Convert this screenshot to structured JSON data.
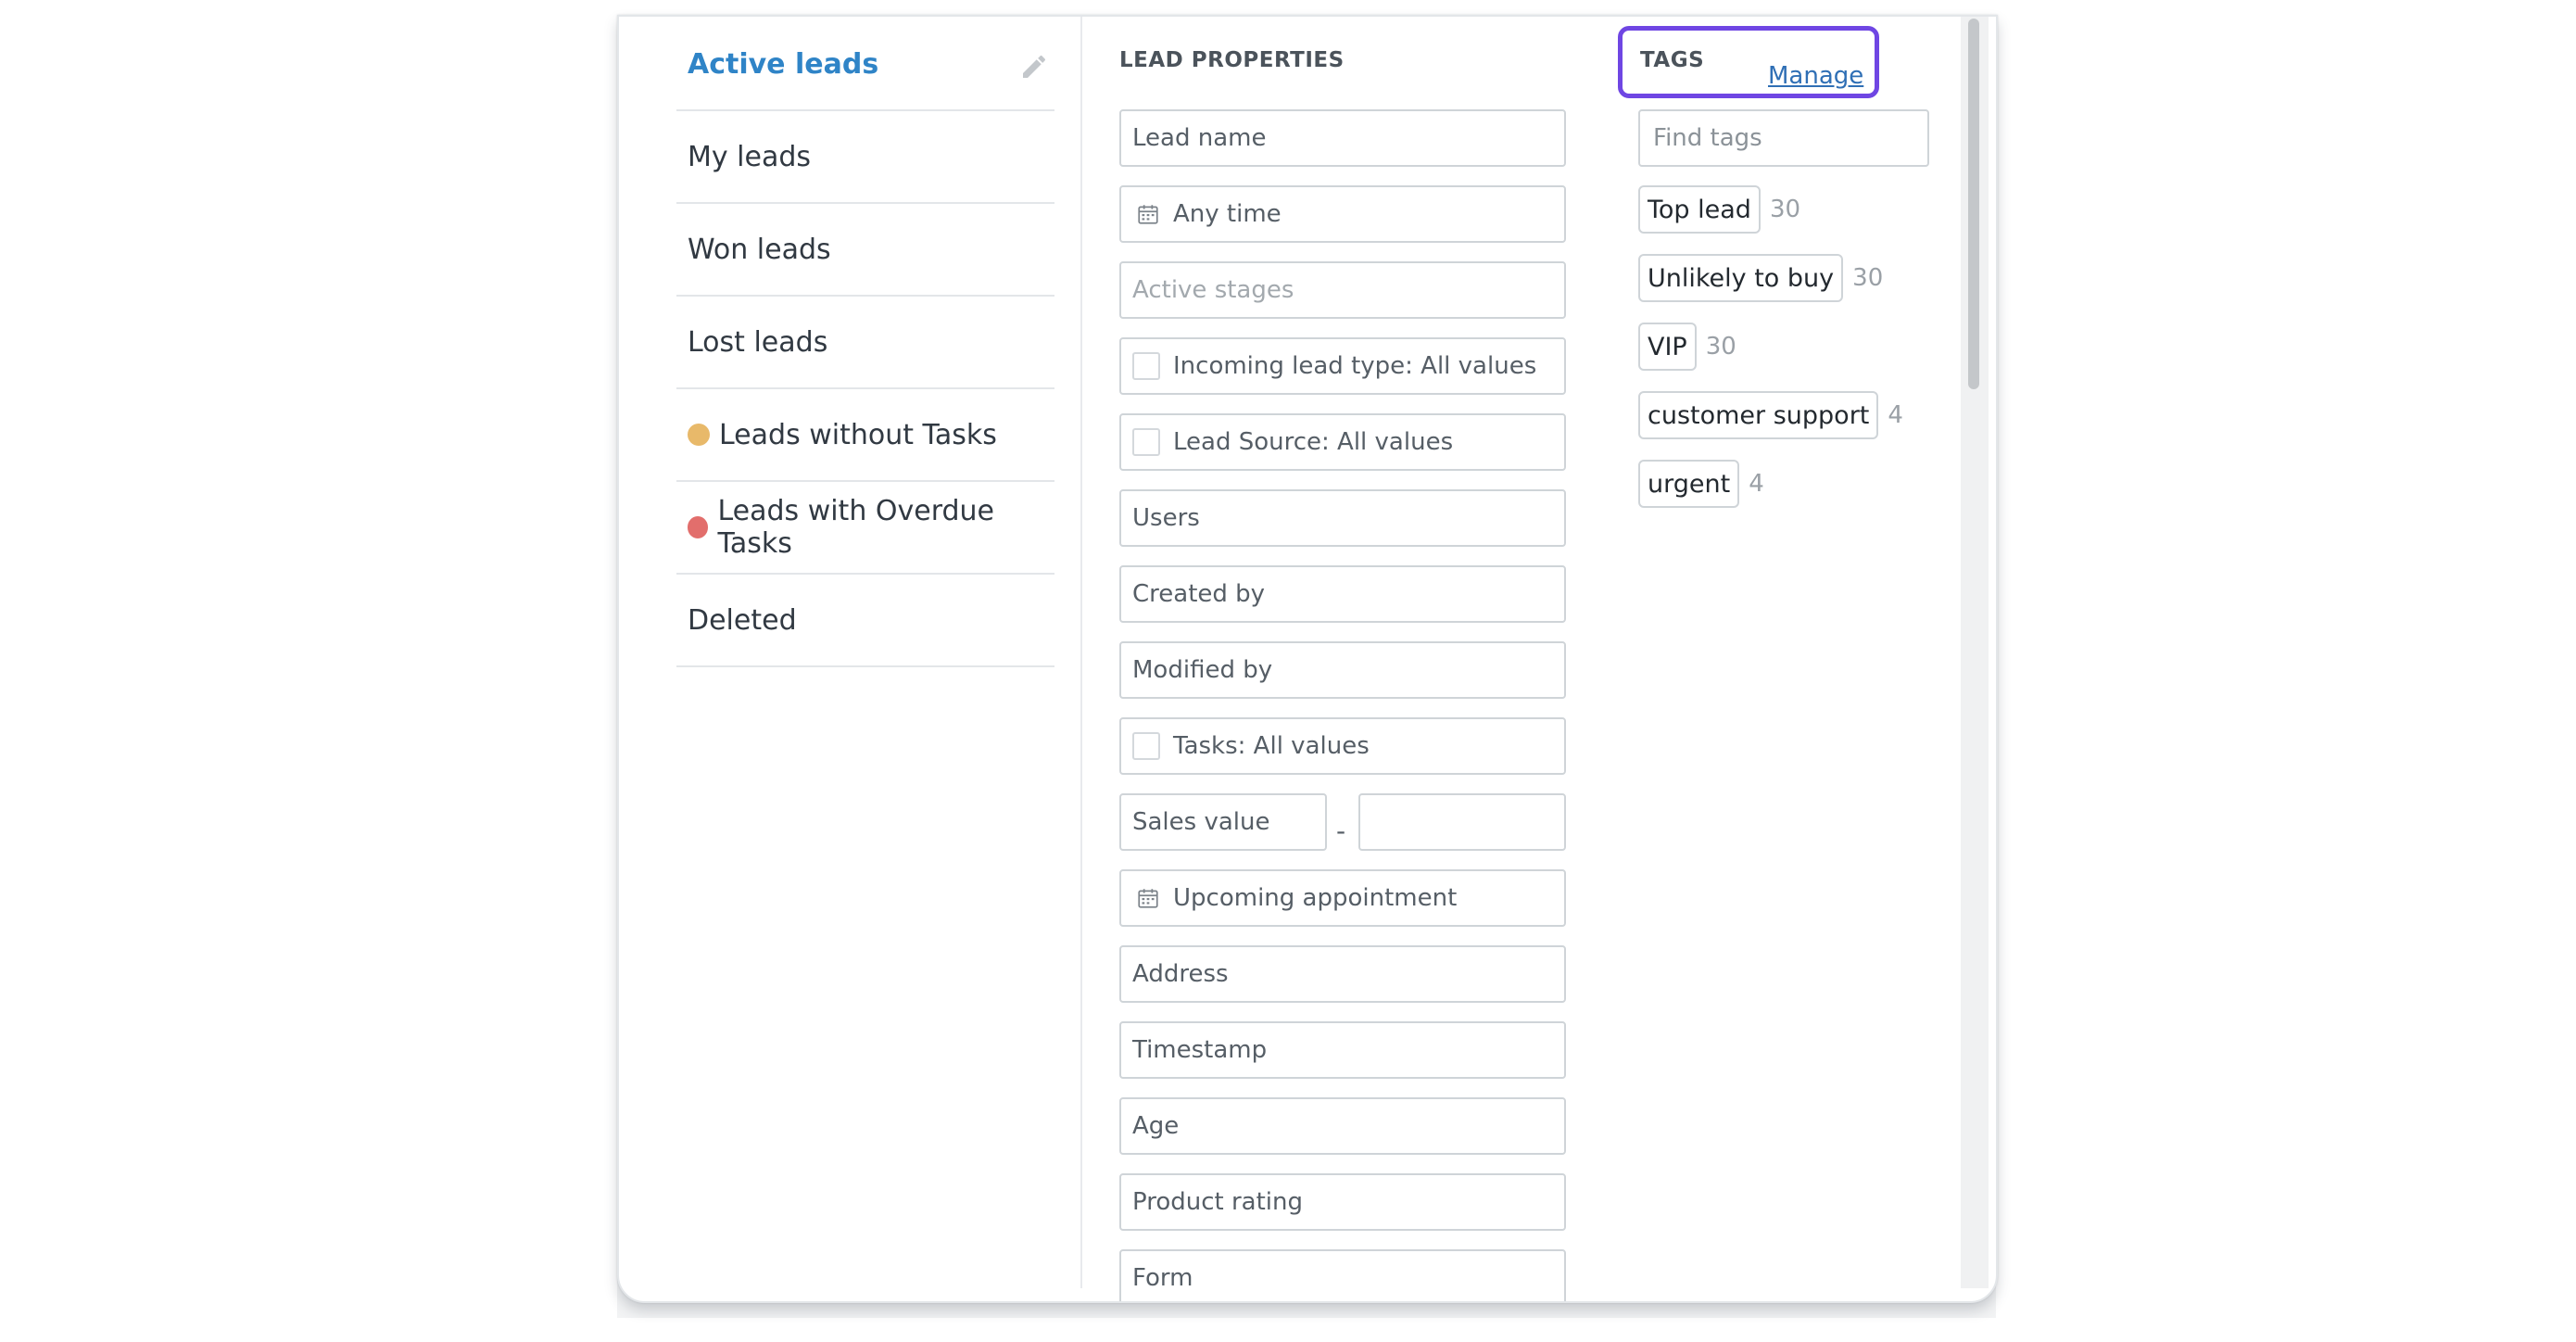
{
  "sidebar": {
    "items": [
      {
        "label": "Active leads",
        "active": true
      },
      {
        "label": "My leads"
      },
      {
        "label": "Won leads"
      },
      {
        "label": "Lost leads"
      },
      {
        "label": "Leads without Tasks",
        "dot_color": "#e8b96a"
      },
      {
        "label": "Leads with Overdue Tasks",
        "dot_color": "#e26e6c"
      },
      {
        "label": "Deleted"
      }
    ]
  },
  "lead_properties": {
    "title": "LEAD PROPERTIES",
    "fields": {
      "lead_name": "Lead name",
      "date": "Any time",
      "stages": "Active stages",
      "incoming_type": "Incoming lead type: All values",
      "lead_source": "Lead Source: All values",
      "users": "Users",
      "created_by": "Created by",
      "modified_by": "Modified by",
      "tasks": "Tasks: All values",
      "sales_value": "Sales value",
      "sales_value_dash": "-",
      "upcoming_appointment": "Upcoming appointment",
      "address": "Address",
      "timestamp": "Timestamp",
      "age": "Age",
      "product_rating": "Product rating",
      "form": "Form"
    }
  },
  "tags": {
    "title": "TAGS",
    "manage_label": "Manage",
    "search_placeholder": "Find tags",
    "accent_color": "#6f46e3",
    "list": [
      {
        "name": "Top lead",
        "count": "30"
      },
      {
        "name": "Unlikely to buy",
        "count": "30"
      },
      {
        "name": "VIP",
        "count": "30"
      },
      {
        "name": "customer support",
        "count": "4"
      },
      {
        "name": "urgent",
        "count": "4"
      }
    ]
  },
  "colors": {
    "active_link": "#2f84c7",
    "link": "#2f6fb5"
  }
}
